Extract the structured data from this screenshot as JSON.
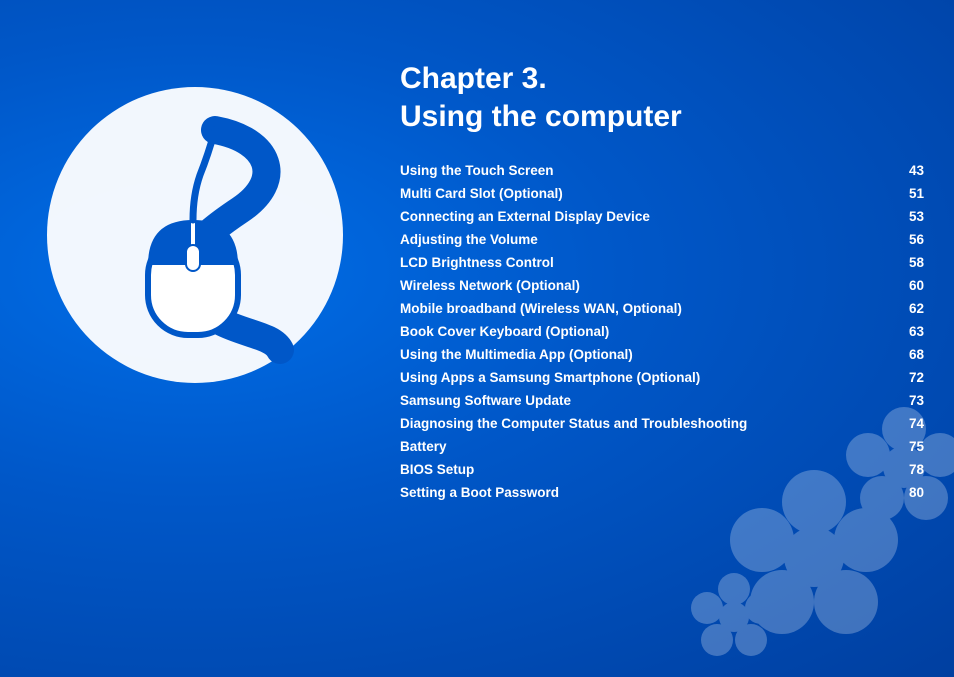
{
  "background": {
    "color": "#0057c8"
  },
  "chapter": {
    "line1": "Chapter 3.",
    "line2": "Using the computer"
  },
  "toc": [
    {
      "label": "Using the Touch Screen",
      "page": "43"
    },
    {
      "label": "Multi Card Slot (Optional)",
      "page": "51"
    },
    {
      "label": "Connecting an External Display Device",
      "page": "53"
    },
    {
      "label": "Adjusting the Volume",
      "page": "56"
    },
    {
      "label": "LCD Brightness Control",
      "page": "58"
    },
    {
      "label": "Wireless Network (Optional)",
      "page": "60"
    },
    {
      "label": "Mobile broadband (Wireless WAN, Optional)",
      "page": "62"
    },
    {
      "label": "Book Cover Keyboard (Optional)",
      "page": "63"
    },
    {
      "label": "Using the Multimedia App (Optional)",
      "page": "68"
    },
    {
      "label": "Using Apps a Samsung Smartphone (Optional)",
      "page": "72"
    },
    {
      "label": "Samsung Software Update",
      "page": "73"
    },
    {
      "label": "Diagnosing the Computer Status and Troubleshooting",
      "page": "74"
    },
    {
      "label": "Battery",
      "page": "75"
    },
    {
      "label": "BIOS Setup",
      "page": "78"
    },
    {
      "label": "Setting a Boot Password",
      "page": "80"
    }
  ]
}
